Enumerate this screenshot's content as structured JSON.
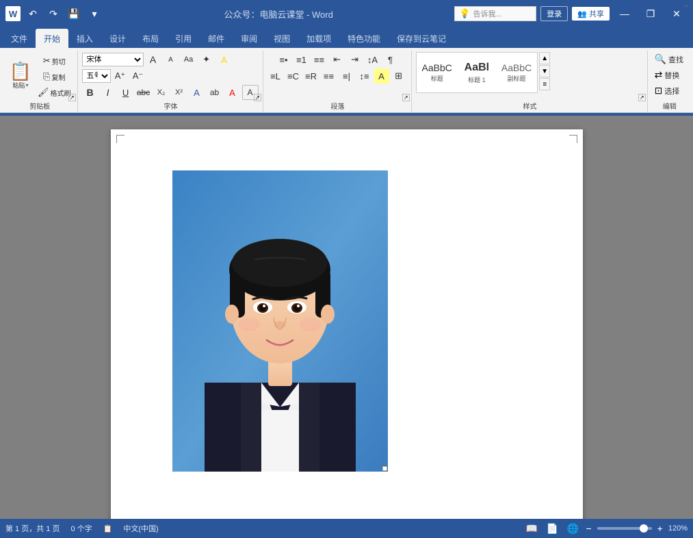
{
  "titlebar": {
    "logo": "W",
    "title": "公众号：电脑云课堂 - Word",
    "qat_buttons": [
      "undo",
      "redo",
      "save",
      "open"
    ],
    "win_buttons": [
      "minimize",
      "restore",
      "close"
    ],
    "login_label": "登录",
    "share_label": "共享",
    "share_icon": "👥"
  },
  "ribbon": {
    "tabs": [
      "文件",
      "开始",
      "插入",
      "设计",
      "布局",
      "引用",
      "邮件",
      "审阅",
      "视图",
      "加载项",
      "特色功能",
      "保存到云笔记"
    ],
    "active_tab": "开始",
    "tell_placeholder": "告诉我...",
    "groups": {
      "clipboard": {
        "label": "剪贴板",
        "paste_label": "粘贴",
        "cut_label": "剪切",
        "copy_label": "复制",
        "format_label": "格式刷"
      },
      "font": {
        "label": "字体",
        "font_name": "宋体",
        "font_size": "五号",
        "buttons": [
          "B",
          "I",
          "U",
          "S",
          "X₂",
          "X²",
          "A",
          "abc",
          "A",
          "A"
        ]
      },
      "paragraph": {
        "label": "段落"
      },
      "styles": {
        "label": "样式",
        "items": [
          {
            "label": "标题",
            "preview": "AaBbC"
          },
          {
            "label": "标题 1",
            "preview": "AaBl"
          },
          {
            "label": "副标题",
            "preview": "AaBbC"
          }
        ]
      },
      "editing": {
        "label": "编辑",
        "find_label": "查找",
        "replace_label": "替换",
        "select_label": "选择"
      }
    }
  },
  "document": {
    "page_content": "passport_photo",
    "photo_alt": "证件照 - 女性商务照"
  },
  "statusbar": {
    "page_info": "第 1 页，共 1 页",
    "word_count": "0 个字",
    "correction_icon": "🔲",
    "language": "中文(中国)",
    "zoom_level": "120%",
    "views": [
      "阅读视图",
      "页面视图",
      "Web视图"
    ]
  }
}
